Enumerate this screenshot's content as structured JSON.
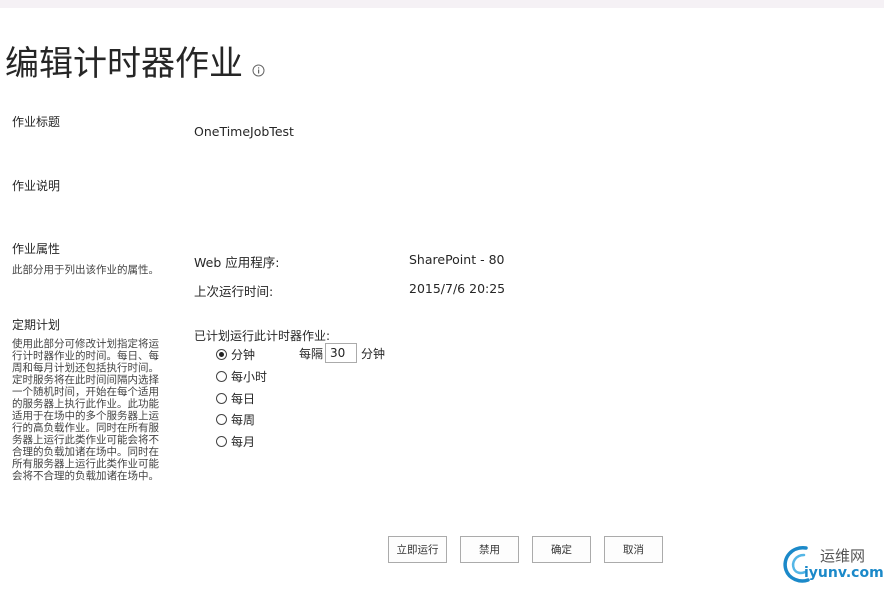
{
  "page": {
    "title": "编辑计时器作业"
  },
  "sections": {
    "job_title": {
      "label": "作业标题",
      "value": "OneTimeJobTest"
    },
    "job_desc": {
      "label": "作业说明"
    },
    "job_props": {
      "label": "作业属性",
      "description": "此部分用于列出该作业的属性。",
      "web_app_label": "Web 应用程序:",
      "web_app_value": "SharePoint - 80",
      "last_run_label": "上次运行时间:",
      "last_run_value": "2015/7/6 20:25"
    },
    "schedule": {
      "label": "定期计划",
      "description_lines": [
        "使用此部分可修改计划指定将运",
        "行计时器作业的时间。每日、每",
        "周和每月计划还包括执行时间。",
        "定时服务将在此时间间隔内选择",
        "一个随机时间，开始在每个适用",
        "的服务器上执行此作业。此功能",
        "适用于在场中的多个服务器上运",
        "行的高负载作业。同时在所有服",
        "务器上运行此类作业可能会将不",
        "合理的负载加诸在场中。同时在",
        "所有服务器上运行此类作业可能",
        "会将不合理的负载加诸在场中。"
      ],
      "run_label": "已计划运行此计时器作业:",
      "options": [
        "分钟",
        "每小时",
        "每日",
        "每周",
        "每月"
      ],
      "selected": "分钟",
      "every_label": "每隔",
      "every_value": "30",
      "every_unit": "分钟"
    }
  },
  "buttons": {
    "run_now": "立即运行",
    "disable": "禁用",
    "ok": "确定",
    "cancel": "取消"
  },
  "watermark": {
    "line1": "运维网",
    "line2": "iyunv.com"
  }
}
